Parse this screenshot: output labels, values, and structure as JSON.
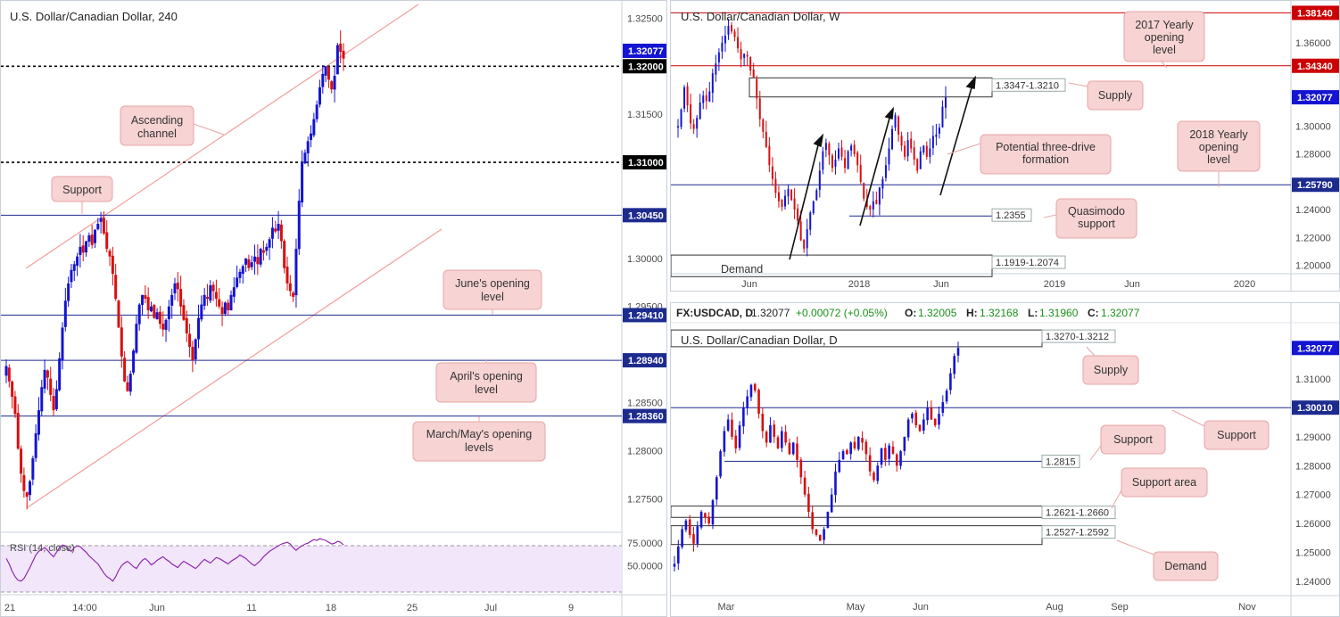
{
  "chart_data": [
    {
      "id": "h4",
      "type": "candlestick",
      "title": "U.S. Dollar/Canadian Dollar, 240",
      "x_ticks": [
        "21",
        "14:00",
        "Jun",
        "11",
        "18",
        "25",
        "Jul",
        "9"
      ],
      "y_ticks": [
        "1.32500",
        "1.31500",
        "1.30000",
        "1.29500",
        "1.28500",
        "1.28000",
        "1.27500"
      ],
      "ylim": [
        1.2715,
        1.3268
      ],
      "levels": [
        {
          "value": 1.32,
          "label": "1.32000",
          "style": "dotted",
          "color": "#000000"
        },
        {
          "value": 1.31,
          "label": "1.31000",
          "style": "dotted",
          "color": "#000000"
        },
        {
          "value": 1.3045,
          "label": "1.30450",
          "style": "solid",
          "color": "#1d2b8f"
        },
        {
          "value": 1.2941,
          "label": "1.29410",
          "style": "solid",
          "color": "#1d2b8f"
        },
        {
          "value": 1.2894,
          "label": "1.28940",
          "style": "solid",
          "color": "#1d2b8f"
        },
        {
          "value": 1.2836,
          "label": "1.28360",
          "style": "solid",
          "color": "#1d2b8f"
        }
      ],
      "current_price": "1.32077",
      "annotations": [
        "Ascending channel",
        "Support",
        "June's opening level",
        "April's opening level",
        "March/May's opening levels"
      ],
      "series_close": [
        1.2888,
        1.2872,
        1.2856,
        1.2838,
        1.2802,
        1.2776,
        1.2758,
        1.2752,
        1.2768,
        1.2792,
        1.2818,
        1.2842,
        1.2866,
        1.2884,
        1.2876,
        1.2858,
        1.2842,
        1.2864,
        1.2896,
        1.2928,
        1.2956,
        1.2974,
        1.2988,
        1.2994,
        1.3002,
        1.3012,
        1.3006,
        1.3018,
        1.3024,
        1.3014,
        1.303,
        1.3036,
        1.3042,
        1.3026,
        1.301,
        1.3002,
        1.2984,
        1.2958,
        1.2928,
        1.2898,
        1.2872,
        1.2862,
        1.288,
        1.2904,
        1.2932,
        1.2952,
        1.2962,
        1.2958,
        1.2946,
        1.295,
        1.2938,
        1.2944,
        1.2932,
        1.2926,
        1.2936,
        1.295,
        1.2962,
        1.2974,
        1.2968,
        1.295,
        1.2936,
        1.2922,
        1.2908,
        1.2894,
        1.2916,
        1.2938,
        1.2952,
        1.2962,
        1.2958,
        1.2972,
        1.2966,
        1.2958,
        1.295,
        1.2942,
        1.2954,
        1.2946,
        1.2962,
        1.297,
        1.298,
        1.2986,
        1.2992,
        1.3,
        1.299,
        1.2996,
        1.3002,
        1.2994,
        1.301,
        1.3006,
        1.3012,
        1.302,
        1.3032,
        1.3028,
        1.3036,
        1.3018,
        1.299,
        1.2974,
        1.2966,
        1.296,
        1.301,
        1.306,
        1.31,
        1.311,
        1.3122,
        1.313,
        1.3145,
        1.316,
        1.3178,
        1.3192,
        1.32,
        1.3186,
        1.3176,
        1.319,
        1.3222,
        1.3215,
        1.3208
      ]
    },
    {
      "id": "rsi",
      "type": "line",
      "title": "RSI (14, close)",
      "y_ticks": [
        "75.0000",
        "50.0000"
      ],
      "ylim": [
        20,
        85
      ],
      "levels": [
        70,
        30
      ],
      "values": [
        58,
        52,
        44,
        38,
        34,
        33,
        36,
        42,
        48,
        55,
        62,
        66,
        68,
        70,
        67,
        63,
        60,
        65,
        70,
        73,
        72,
        68,
        66,
        70,
        72,
        71,
        68,
        65,
        61,
        58,
        55,
        52,
        47,
        42,
        38,
        36,
        33,
        38,
        45,
        50,
        53,
        55,
        52,
        49,
        47,
        52,
        56,
        58,
        55,
        51,
        53,
        56,
        58,
        60,
        57,
        55,
        52,
        50,
        48,
        52,
        55,
        53,
        51,
        49,
        47,
        50,
        54,
        57,
        55,
        53,
        56,
        59,
        58,
        56,
        54,
        52,
        55,
        57,
        59,
        62,
        60,
        58,
        55,
        52,
        50,
        53,
        56,
        60,
        63,
        66,
        68,
        70,
        72,
        74,
        75,
        76,
        74,
        70,
        67,
        70,
        72,
        74,
        75,
        77,
        79,
        78,
        80,
        79,
        78,
        76,
        74,
        75,
        77,
        76,
        73
      ]
    },
    {
      "id": "weekly",
      "type": "candlestick",
      "title": "U.S. Dollar/Canadian Dollar, W",
      "x_ticks": [
        "Jun",
        "2018",
        "Jun",
        "2019",
        "Jun",
        "2020"
      ],
      "y_ticks": [
        "1.36000",
        "1.30000",
        "1.28000",
        "1.26000",
        "1.24000",
        "1.22000",
        "1.20000"
      ],
      "ylim": [
        1.194,
        1.39
      ],
      "levels": [
        {
          "value": 1.3814,
          "label": "1.38140",
          "color": "#cc0000"
        },
        {
          "value": 1.3434,
          "label": "1.34340",
          "color": "#cc0000"
        },
        {
          "value": 1.2579,
          "label": "1.25790",
          "color": "#1d2b8f"
        }
      ],
      "zones": [
        {
          "label": "1.3347-1.3210",
          "high": 1.3347,
          "low": 1.321
        },
        {
          "label": "1.1919-1.2074",
          "high": 1.2074,
          "low": 1.1919
        }
      ],
      "qm_level": {
        "value": 1.2355,
        "label": "1.2355"
      },
      "current_price": "1.32077",
      "annotations": [
        "2017 Yearly opening level",
        "Supply",
        "Potential three-drive formation",
        "2018 Yearly opening level",
        "Quasimodo support",
        "Demand"
      ],
      "series_close": [
        1.3,
        1.312,
        1.328,
        1.315,
        1.302,
        1.298,
        1.306,
        1.317,
        1.322,
        1.318,
        1.325,
        1.338,
        1.345,
        1.353,
        1.36,
        1.365,
        1.372,
        1.368,
        1.364,
        1.356,
        1.348,
        1.352,
        1.35,
        1.34,
        1.335,
        1.32,
        1.305,
        1.296,
        1.285,
        1.272,
        1.262,
        1.252,
        1.246,
        1.242,
        1.25,
        1.255,
        1.247,
        1.24,
        1.232,
        1.218,
        1.212,
        1.226,
        1.238,
        1.246,
        1.254,
        1.268,
        1.282,
        1.288,
        1.279,
        1.27,
        1.276,
        1.284,
        1.278,
        1.27,
        1.282,
        1.286,
        1.28,
        1.272,
        1.26,
        1.248,
        1.242,
        1.24,
        1.246,
        1.244,
        1.256,
        1.262,
        1.272,
        1.284,
        1.298,
        1.308,
        1.294,
        1.286,
        1.278,
        1.29,
        1.284,
        1.276,
        1.268,
        1.282,
        1.286,
        1.278,
        1.284,
        1.293,
        1.294,
        1.299,
        1.314,
        1.3207
      ]
    },
    {
      "id": "daily",
      "type": "candlestick",
      "title": "U.S. Dollar/Canadian Dollar, D",
      "info_bar": {
        "symbol": "FX:USDCAD, D",
        "last": "1.32077",
        "change": "+0.00072 (+0.05%)",
        "open": "1.32005",
        "high": "1.32168",
        "low": "1.31960",
        "close": "1.32077"
      },
      "x_ticks": [
        "Mar",
        "May",
        "Jun",
        "Aug",
        "Sep",
        "Nov"
      ],
      "y_ticks": [
        "1.31000",
        "1.29000",
        "1.28000",
        "1.27000",
        "1.26000",
        "1.25000",
        "1.24000"
      ],
      "ylim": [
        1.235,
        1.3295
      ],
      "levels": [
        {
          "value": 1.3001,
          "label": "1.30010",
          "color": "#1d2b8f"
        },
        {
          "value": 1.2815,
          "label": "1.2815",
          "color": "#1d2b8f"
        }
      ],
      "zones": [
        {
          "label": "1.3270-1.3212",
          "high": 1.327,
          "low": 1.3212
        },
        {
          "label": "1.2621-1.2660",
          "high": 1.266,
          "low": 1.2621
        },
        {
          "label": "1.2527-1.2592",
          "high": 1.2592,
          "low": 1.2527
        }
      ],
      "current_price": "1.32077",
      "annotations": [
        "Supply",
        "Support",
        "Support",
        "Support area",
        "Demand"
      ],
      "series_close": [
        1.246,
        1.252,
        1.258,
        1.261,
        1.256,
        1.253,
        1.259,
        1.264,
        1.262,
        1.26,
        1.268,
        1.276,
        1.285,
        1.292,
        1.296,
        1.29,
        1.286,
        1.294,
        1.3,
        1.304,
        1.308,
        1.306,
        1.298,
        1.292,
        1.288,
        1.294,
        1.29,
        1.286,
        1.292,
        1.288,
        1.284,
        1.288,
        1.282,
        1.276,
        1.27,
        1.264,
        1.258,
        1.256,
        1.254,
        1.258,
        1.264,
        1.27,
        1.278,
        1.282,
        1.285,
        1.284,
        1.288,
        1.286,
        1.29,
        1.288,
        1.284,
        1.278,
        1.275,
        1.28,
        1.286,
        1.282,
        1.287,
        1.284,
        1.28,
        1.285,
        1.29,
        1.296,
        1.298,
        1.294,
        1.292,
        1.296,
        1.3,
        1.296,
        1.294,
        1.298,
        1.302,
        1.306,
        1.312,
        1.318,
        1.3208
      ]
    }
  ]
}
